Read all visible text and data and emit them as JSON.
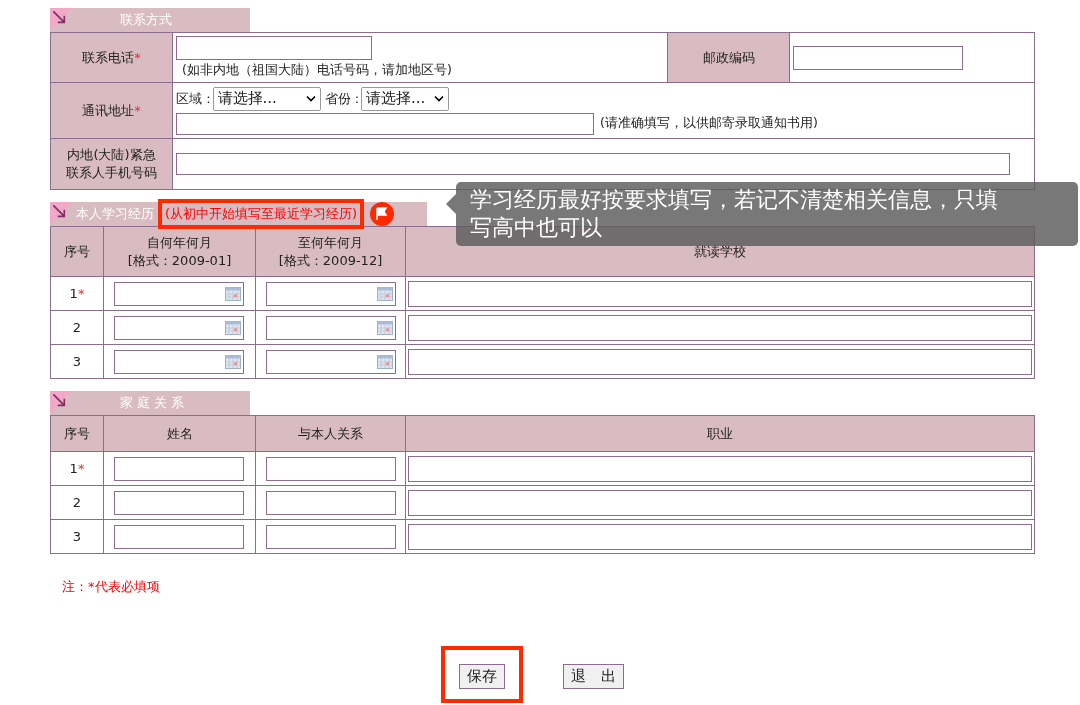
{
  "contact_section": {
    "title": "联系方式",
    "phone": {
      "label": "联系电话",
      "required_mark": "*",
      "hint": "(如非内地（祖国大陆）电话号码，请加地区号)"
    },
    "postal": {
      "label": "邮政编码"
    },
    "address": {
      "label": "通讯地址",
      "required_mark": "*",
      "region_label": "区域 :",
      "region_value": "请选择...",
      "province_label": "省份 :",
      "province_value": "请选择...",
      "hint": "(请准确填写，以供邮寄录取通知书用)"
    },
    "emergency": {
      "label_lines": [
        "内地(大陆)紧急",
        "联系人手机号码"
      ]
    }
  },
  "study_section": {
    "title": "本人学习经历",
    "note": "(从初中开始填写至最近学习经历)",
    "note_highlighted": true,
    "columns": [
      {
        "lines": [
          "序号"
        ]
      },
      {
        "lines": [
          "自何年何月",
          "[格式：2009-01]"
        ]
      },
      {
        "lines": [
          "至何年何月",
          "[格式：2009-12]"
        ]
      },
      {
        "lines": [
          "就读学校"
        ]
      }
    ],
    "rows": [
      {
        "index": "1",
        "required_mark": "*"
      },
      {
        "index": "2"
      },
      {
        "index": "3"
      }
    ]
  },
  "family_section": {
    "title": "家 庭 关 系",
    "columns": [
      {
        "lines": [
          "序号"
        ]
      },
      {
        "lines": [
          "姓名"
        ]
      },
      {
        "lines": [
          "与本人关系"
        ]
      },
      {
        "lines": [
          "职业"
        ]
      }
    ],
    "rows": [
      {
        "index": "1",
        "required_mark": "*"
      },
      {
        "index": "2"
      },
      {
        "index": "3"
      }
    ]
  },
  "footnote": "注：*代表必填项",
  "buttons": [
    {
      "label": "保存",
      "highlighted": true
    },
    {
      "label": "退　出",
      "highlighted": false
    }
  ],
  "tooltip": {
    "text": "学习经历最好按要求填写，若记不清楚相关信息，只填写高中也可以"
  }
}
